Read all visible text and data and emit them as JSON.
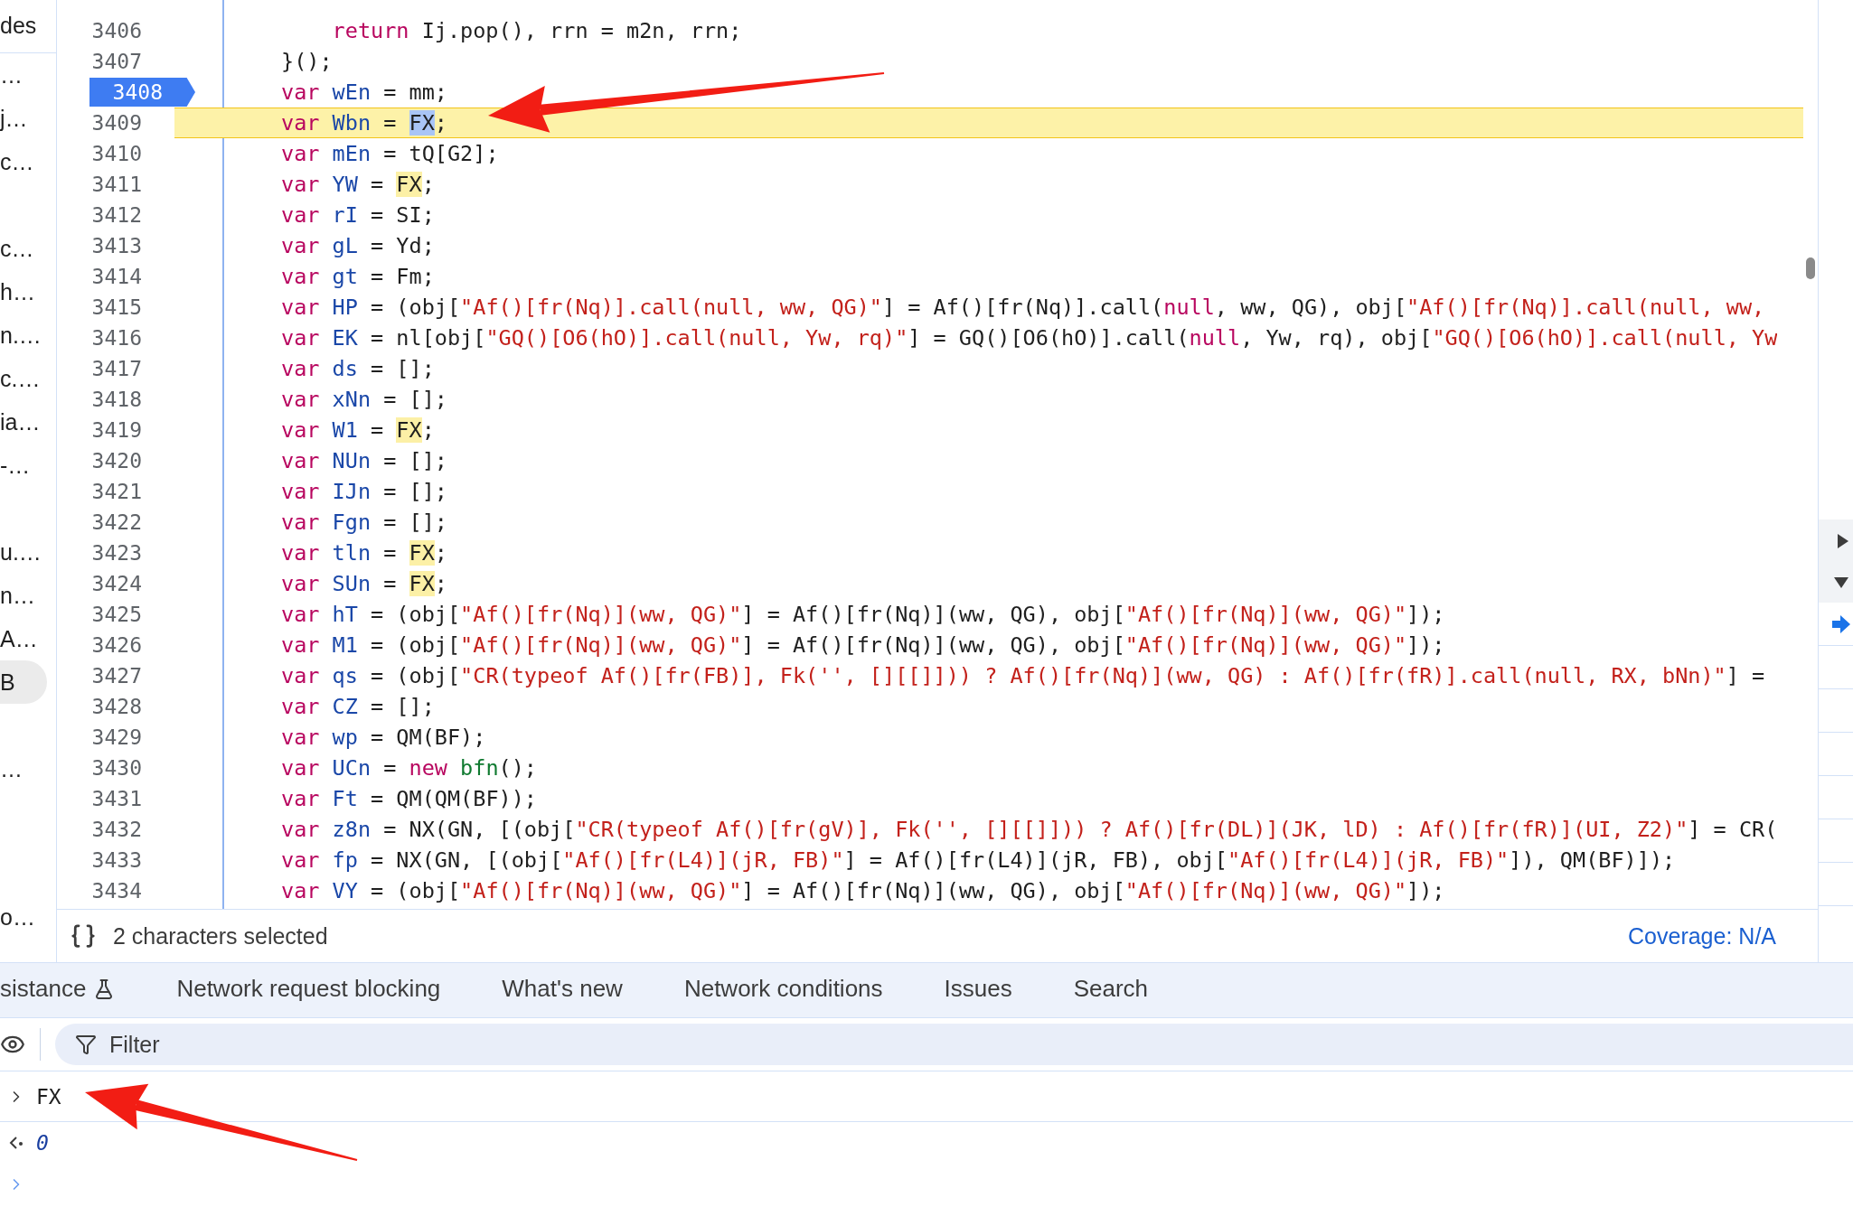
{
  "sidebar": {
    "header": "des",
    "groups": [
      [
        {
          "label": "…",
          "selected": false
        },
        {
          "label": "j…",
          "selected": false
        },
        {
          "label": "c…",
          "selected": false
        }
      ],
      [
        {
          "label": "c…",
          "selected": false
        },
        {
          "label": "h…",
          "selected": false
        },
        {
          "label": "n.…",
          "selected": false
        },
        {
          "label": "c.…",
          "selected": false
        },
        {
          "label": "ia…",
          "selected": false
        },
        {
          "label": "-…",
          "selected": false
        }
      ],
      [
        {
          "label": "u.…",
          "selected": false
        },
        {
          "label": "n…",
          "selected": false
        },
        {
          "label": "A…",
          "selected": false
        },
        {
          "label": "B",
          "selected": true
        }
      ],
      [
        {
          "label": "…",
          "selected": false
        }
      ],
      [
        {
          "label": "o…",
          "selected": false
        }
      ]
    ]
  },
  "editor": {
    "lines": [
      {
        "n": "3406",
        "current": false,
        "highlighted": false,
        "tokens": [
          {
            "kind": "kw",
            "text": "    return"
          },
          {
            "kind": "p",
            "text": " Ij.pop(), rrn = m2n, rrn;"
          }
        ]
      },
      {
        "n": "3407",
        "current": false,
        "highlighted": false,
        "tokens": [
          {
            "kind": "p",
            "text": "}();"
          }
        ]
      },
      {
        "n": "3408",
        "current": true,
        "highlighted": false,
        "tokens": [
          {
            "kind": "kw",
            "text": "var"
          },
          {
            "kind": "def",
            "text": " wEn"
          },
          {
            "kind": "p",
            "text": " = mm;"
          }
        ]
      },
      {
        "n": "3409",
        "current": false,
        "highlighted": true,
        "tokens": [
          {
            "kind": "kw",
            "text": "var"
          },
          {
            "kind": "def",
            "text": " Wbn"
          },
          {
            "kind": "p",
            "text": " = "
          },
          {
            "kind": "sel",
            "text": "FX"
          },
          {
            "kind": "p",
            "text": ";"
          }
        ]
      },
      {
        "n": "3410",
        "current": false,
        "highlighted": false,
        "tokens": [
          {
            "kind": "kw",
            "text": "var"
          },
          {
            "kind": "def",
            "text": " mEn"
          },
          {
            "kind": "p",
            "text": " = tQ[G2];"
          }
        ]
      },
      {
        "n": "3411",
        "current": false,
        "highlighted": false,
        "tokens": [
          {
            "kind": "kw",
            "text": "var"
          },
          {
            "kind": "def",
            "text": " YW"
          },
          {
            "kind": "p",
            "text": " = "
          },
          {
            "kind": "match",
            "text": "FX"
          },
          {
            "kind": "p",
            "text": ";"
          }
        ]
      },
      {
        "n": "3412",
        "current": false,
        "highlighted": false,
        "tokens": [
          {
            "kind": "kw",
            "text": "var"
          },
          {
            "kind": "def",
            "text": " rI"
          },
          {
            "kind": "p",
            "text": " = SI;"
          }
        ]
      },
      {
        "n": "3413",
        "current": false,
        "highlighted": false,
        "tokens": [
          {
            "kind": "kw",
            "text": "var"
          },
          {
            "kind": "def",
            "text": " gL"
          },
          {
            "kind": "p",
            "text": " = Yd;"
          }
        ]
      },
      {
        "n": "3414",
        "current": false,
        "highlighted": false,
        "tokens": [
          {
            "kind": "kw",
            "text": "var"
          },
          {
            "kind": "def",
            "text": " gt"
          },
          {
            "kind": "p",
            "text": " = Fm;"
          }
        ]
      },
      {
        "n": "3415",
        "current": false,
        "highlighted": false,
        "tokens": [
          {
            "kind": "kw",
            "text": "var"
          },
          {
            "kind": "def",
            "text": " HP"
          },
          {
            "kind": "p",
            "text": " = (obj["
          },
          {
            "kind": "str",
            "text": "\"Af()[fr(Nq)].call(null, ww, QG)\""
          },
          {
            "kind": "p",
            "text": "] = Af()[fr(Nq)].call("
          },
          {
            "kind": "kw",
            "text": "null"
          },
          {
            "kind": "p",
            "text": ", ww, QG), obj["
          },
          {
            "kind": "str",
            "text": "\"Af()[fr(Nq)].call(null, ww,"
          }
        ]
      },
      {
        "n": "3416",
        "current": false,
        "highlighted": false,
        "tokens": [
          {
            "kind": "kw",
            "text": "var"
          },
          {
            "kind": "def",
            "text": " EK"
          },
          {
            "kind": "p",
            "text": " = nl[obj["
          },
          {
            "kind": "str",
            "text": "\"GQ()[O6(hO)].call(null, Yw, rq)\""
          },
          {
            "kind": "p",
            "text": "] = GQ()[O6(hO)].call("
          },
          {
            "kind": "kw",
            "text": "null"
          },
          {
            "kind": "p",
            "text": ", Yw, rq), obj["
          },
          {
            "kind": "str",
            "text": "\"GQ()[O6(hO)].call(null, Yw"
          }
        ]
      },
      {
        "n": "3417",
        "current": false,
        "highlighted": false,
        "tokens": [
          {
            "kind": "kw",
            "text": "var"
          },
          {
            "kind": "def",
            "text": " ds"
          },
          {
            "kind": "p",
            "text": " = [];"
          }
        ]
      },
      {
        "n": "3418",
        "current": false,
        "highlighted": false,
        "tokens": [
          {
            "kind": "kw",
            "text": "var"
          },
          {
            "kind": "def",
            "text": " xNn"
          },
          {
            "kind": "p",
            "text": " = [];"
          }
        ]
      },
      {
        "n": "3419",
        "current": false,
        "highlighted": false,
        "tokens": [
          {
            "kind": "kw",
            "text": "var"
          },
          {
            "kind": "def",
            "text": " W1"
          },
          {
            "kind": "p",
            "text": " = "
          },
          {
            "kind": "match",
            "text": "FX"
          },
          {
            "kind": "p",
            "text": ";"
          }
        ]
      },
      {
        "n": "3420",
        "current": false,
        "highlighted": false,
        "tokens": [
          {
            "kind": "kw",
            "text": "var"
          },
          {
            "kind": "def",
            "text": " NUn"
          },
          {
            "kind": "p",
            "text": " = [];"
          }
        ]
      },
      {
        "n": "3421",
        "current": false,
        "highlighted": false,
        "tokens": [
          {
            "kind": "kw",
            "text": "var"
          },
          {
            "kind": "def",
            "text": " IJn"
          },
          {
            "kind": "p",
            "text": " = [];"
          }
        ]
      },
      {
        "n": "3422",
        "current": false,
        "highlighted": false,
        "tokens": [
          {
            "kind": "kw",
            "text": "var"
          },
          {
            "kind": "def",
            "text": " Fgn"
          },
          {
            "kind": "p",
            "text": " = [];"
          }
        ]
      },
      {
        "n": "3423",
        "current": false,
        "highlighted": false,
        "tokens": [
          {
            "kind": "kw",
            "text": "var"
          },
          {
            "kind": "def",
            "text": " tln"
          },
          {
            "kind": "p",
            "text": " = "
          },
          {
            "kind": "match",
            "text": "FX"
          },
          {
            "kind": "p",
            "text": ";"
          }
        ]
      },
      {
        "n": "3424",
        "current": false,
        "highlighted": false,
        "tokens": [
          {
            "kind": "kw",
            "text": "var"
          },
          {
            "kind": "def",
            "text": " SUn"
          },
          {
            "kind": "p",
            "text": " = "
          },
          {
            "kind": "match",
            "text": "FX"
          },
          {
            "kind": "p",
            "text": ";"
          }
        ]
      },
      {
        "n": "3425",
        "current": false,
        "highlighted": false,
        "tokens": [
          {
            "kind": "kw",
            "text": "var"
          },
          {
            "kind": "def",
            "text": " hT"
          },
          {
            "kind": "p",
            "text": " = (obj["
          },
          {
            "kind": "str",
            "text": "\"Af()[fr(Nq)](ww, QG)\""
          },
          {
            "kind": "p",
            "text": "] = Af()[fr(Nq)](ww, QG), obj["
          },
          {
            "kind": "str",
            "text": "\"Af()[fr(Nq)](ww, QG)\""
          },
          {
            "kind": "p",
            "text": "]);"
          }
        ]
      },
      {
        "n": "3426",
        "current": false,
        "highlighted": false,
        "tokens": [
          {
            "kind": "kw",
            "text": "var"
          },
          {
            "kind": "def",
            "text": " M1"
          },
          {
            "kind": "p",
            "text": " = (obj["
          },
          {
            "kind": "str",
            "text": "\"Af()[fr(Nq)](ww, QG)\""
          },
          {
            "kind": "p",
            "text": "] = Af()[fr(Nq)](ww, QG), obj["
          },
          {
            "kind": "str",
            "text": "\"Af()[fr(Nq)](ww, QG)\""
          },
          {
            "kind": "p",
            "text": "]);"
          }
        ]
      },
      {
        "n": "3427",
        "current": false,
        "highlighted": false,
        "tokens": [
          {
            "kind": "kw",
            "text": "var"
          },
          {
            "kind": "def",
            "text": " qs"
          },
          {
            "kind": "p",
            "text": " = (obj["
          },
          {
            "kind": "str",
            "text": "\"CR(typeof Af()[fr(FB)], Fk('', [][[]])) ? Af()[fr(Nq)](ww, QG) : Af()[fr(fR)].call(null, RX, bNn)\""
          },
          {
            "kind": "p",
            "text": "] ="
          }
        ]
      },
      {
        "n": "3428",
        "current": false,
        "highlighted": false,
        "tokens": [
          {
            "kind": "kw",
            "text": "var"
          },
          {
            "kind": "def",
            "text": " CZ"
          },
          {
            "kind": "p",
            "text": " = [];"
          }
        ]
      },
      {
        "n": "3429",
        "current": false,
        "highlighted": false,
        "tokens": [
          {
            "kind": "kw",
            "text": "var"
          },
          {
            "kind": "def",
            "text": " wp"
          },
          {
            "kind": "p",
            "text": " = QM(BF);"
          }
        ]
      },
      {
        "n": "3430",
        "current": false,
        "highlighted": false,
        "tokens": [
          {
            "kind": "kw",
            "text": "var"
          },
          {
            "kind": "def",
            "text": " UCn"
          },
          {
            "kind": "p",
            "text": " = "
          },
          {
            "kind": "kw",
            "text": "new"
          },
          {
            "kind": "fn",
            "text": " bfn"
          },
          {
            "kind": "p",
            "text": "();"
          }
        ]
      },
      {
        "n": "3431",
        "current": false,
        "highlighted": false,
        "tokens": [
          {
            "kind": "kw",
            "text": "var"
          },
          {
            "kind": "def",
            "text": " Ft"
          },
          {
            "kind": "p",
            "text": " = QM(QM(BF));"
          }
        ]
      },
      {
        "n": "3432",
        "current": false,
        "highlighted": false,
        "tokens": [
          {
            "kind": "kw",
            "text": "var"
          },
          {
            "kind": "def",
            "text": " z8n"
          },
          {
            "kind": "p",
            "text": " = NX(GN, [(obj["
          },
          {
            "kind": "str",
            "text": "\"CR(typeof Af()[fr(gV)], Fk('', [][[]])) ? Af()[fr(DL)](JK, lD) : Af()[fr(fR)](UI, Z2)\""
          },
          {
            "kind": "p",
            "text": "] = CR("
          }
        ]
      },
      {
        "n": "3433",
        "current": false,
        "highlighted": false,
        "tokens": [
          {
            "kind": "kw",
            "text": "var"
          },
          {
            "kind": "def",
            "text": " fp"
          },
          {
            "kind": "p",
            "text": " = NX(GN, [(obj["
          },
          {
            "kind": "str",
            "text": "\"Af()[fr(L4)](jR, FB)\""
          },
          {
            "kind": "p",
            "text": "] = Af()[fr(L4)](jR, FB), obj["
          },
          {
            "kind": "str",
            "text": "\"Af()[fr(L4)](jR, FB)\""
          },
          {
            "kind": "p",
            "text": "]), QM(BF)]);"
          }
        ]
      },
      {
        "n": "3434",
        "current": false,
        "highlighted": false,
        "tokens": [
          {
            "kind": "kw",
            "text": "var"
          },
          {
            "kind": "def",
            "text": " VY"
          },
          {
            "kind": "p",
            "text": " = (obj["
          },
          {
            "kind": "str",
            "text": "\"Af()[fr(Nq)](ww, QG)\""
          },
          {
            "kind": "p",
            "text": "] = Af()[fr(Nq)](ww, QG), obj["
          },
          {
            "kind": "str",
            "text": "\"Af()[fr(Nq)](ww, QG)\""
          },
          {
            "kind": "p",
            "text": "]);"
          }
        ]
      }
    ]
  },
  "status_bar": {
    "selection": "2 characters selected",
    "coverage": "Coverage: N/A"
  },
  "drawer_tabs": [
    {
      "label": "sistance",
      "selected": false,
      "experimental": true
    },
    {
      "label": "Network request blocking",
      "selected": false,
      "experimental": false
    },
    {
      "label": "What's new",
      "selected": false,
      "experimental": false
    },
    {
      "label": "Network conditions",
      "selected": false,
      "experimental": false
    },
    {
      "label": "Issues",
      "selected": false,
      "experimental": false
    },
    {
      "label": "Search",
      "selected": false,
      "experimental": false
    }
  ],
  "console": {
    "filter_placeholder": "Filter",
    "entries": [
      {
        "kind": "input",
        "text": "FX"
      },
      {
        "kind": "result",
        "text": "0"
      }
    ]
  }
}
